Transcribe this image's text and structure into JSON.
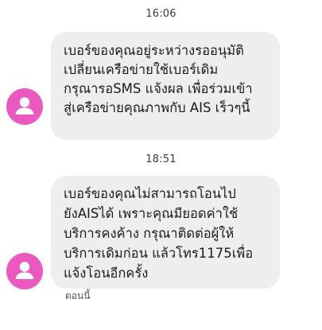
{
  "thread": {
    "messages": [
      {
        "time": "16:06",
        "lines": [
          "เบอร์ของคุณอยู่ระหว่างรออนุมัติ",
          "เปลี่ยนเครือข่ายใช้เบอร์เดิม",
          "กรุณารอSMS แจ้งผล เพื่อร่วมเข้า",
          "สู่เครือข่ายคุณภาพกับ AIS เร็วๆนี้"
        ]
      },
      {
        "time": "18:51",
        "lines": [
          "เบอร์ของคุณไม่สามารถโอนไป",
          "ยังAISได้ เพราะคุณมียอดค่าใช้",
          "บริการคงค้าง กรุณาติดต่อผู้ให้",
          "บริการเดิมก่อน แล้วโทร1175เพื่อ",
          "แจ้งโอนอีกครั้ง"
        ],
        "status": "ตอนนี้"
      }
    ]
  },
  "colors": {
    "avatar": "#ea58c0",
    "bubble": "#eeeeef"
  },
  "icons": {
    "avatar": "person-silhouette-icon"
  }
}
